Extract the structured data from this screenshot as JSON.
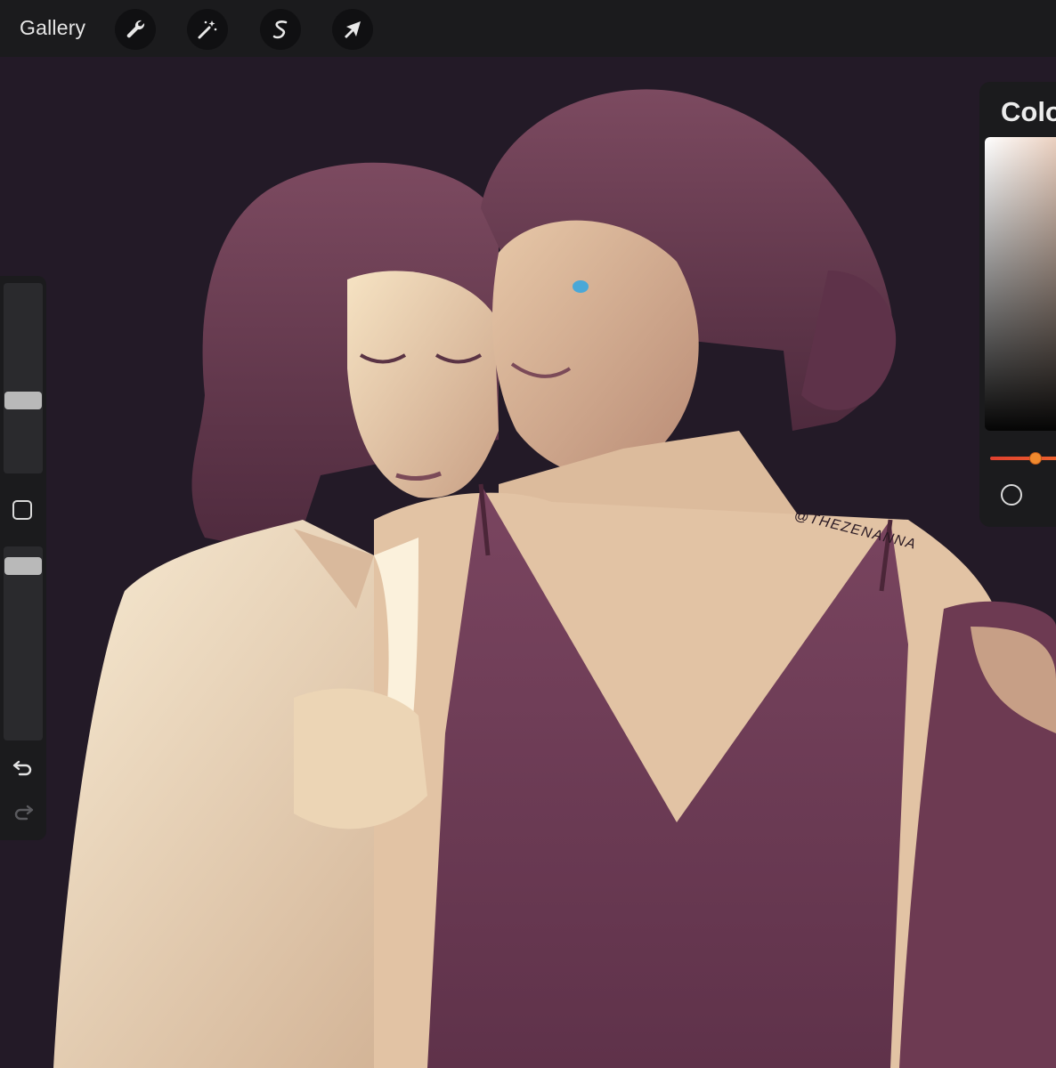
{
  "topbar": {
    "gallery_label": "Gallery",
    "tools": [
      {
        "name": "actions",
        "icon": "wrench-icon"
      },
      {
        "name": "adjustments",
        "icon": "magic-wand-icon"
      },
      {
        "name": "selection",
        "icon": "selection-s-icon"
      },
      {
        "name": "transform",
        "icon": "arrow-cursor-icon"
      }
    ]
  },
  "canvas": {
    "signature": "@THEZENANNA",
    "colors": {
      "background": "#231a27",
      "skin_light": "#f2dbb9",
      "skin_mid": "#c79f86",
      "hair": "#6e3f55",
      "dress": "#6d3a52",
      "shirt": "#efe0c6",
      "eye": "#4aa8d8"
    }
  },
  "sidebar": {
    "brush_size_level": 0.25,
    "opacity_level": 0.95,
    "modify_icon": "square-icon",
    "undo_icon": "undo-icon",
    "redo_icon": "redo-icon"
  },
  "color_panel": {
    "title": "Colo",
    "selected_hue": "#f08a2e",
    "accent": "#e0402f"
  }
}
